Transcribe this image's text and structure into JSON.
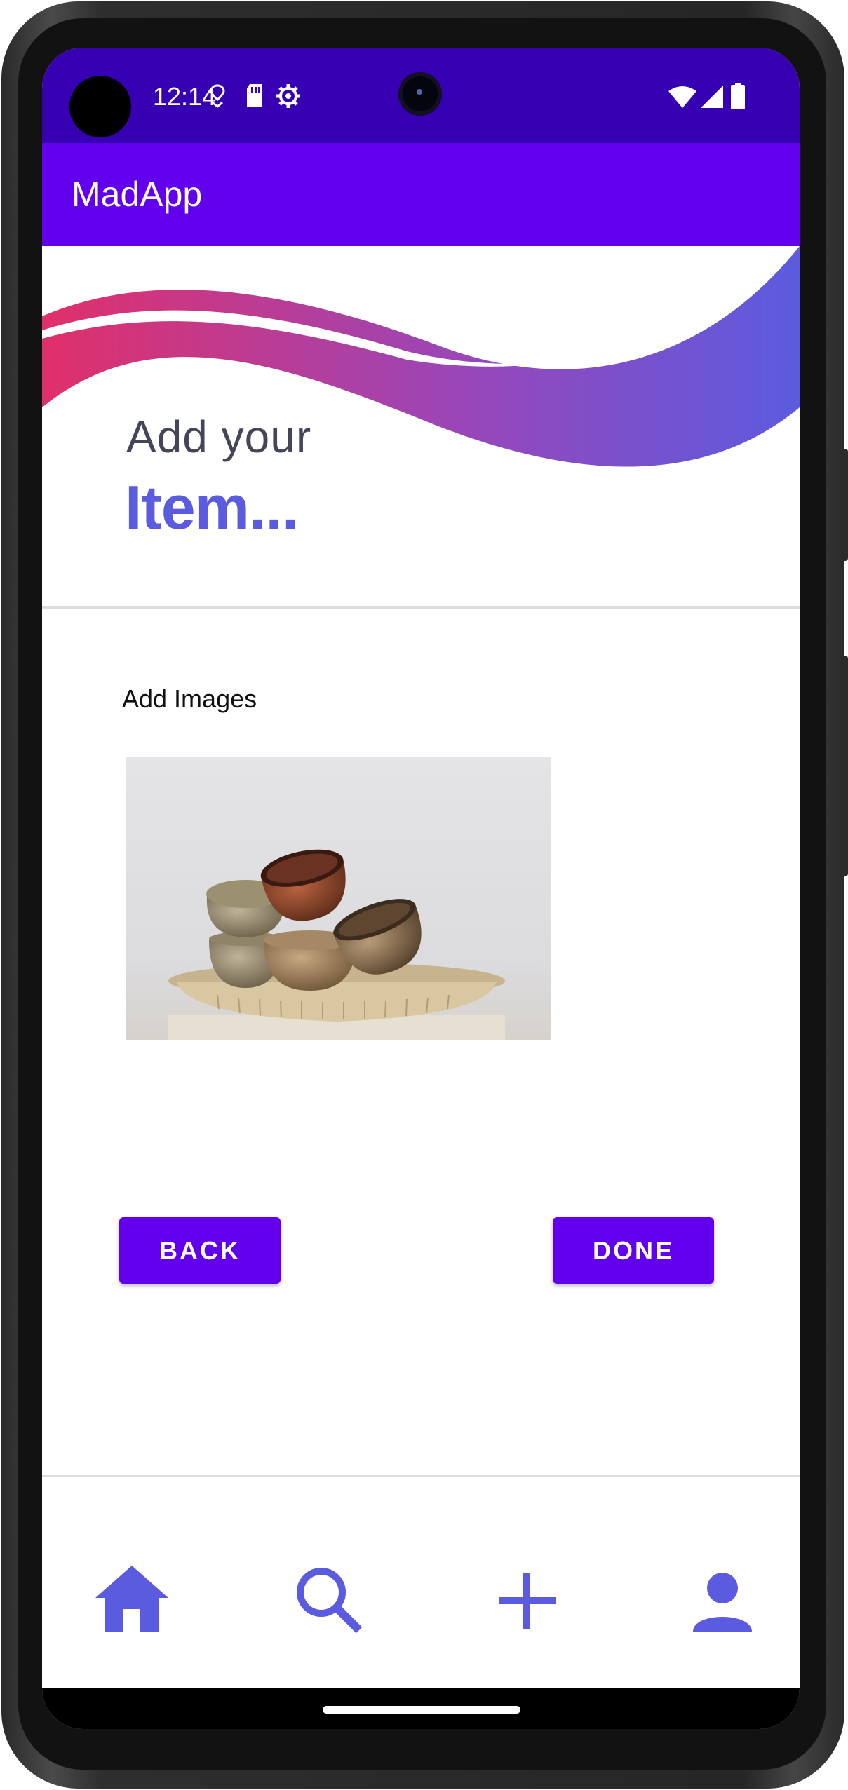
{
  "status_bar": {
    "time": "12:14",
    "icons": [
      "location-pin-icon",
      "sd-card-icon",
      "settings-gear-icon",
      "wifi-icon",
      "cell-signal-icon",
      "battery-icon"
    ]
  },
  "app_bar": {
    "title": "MadApp"
  },
  "header": {
    "line1": "Add your",
    "line2": "Item..."
  },
  "images_section": {
    "label": "Add Images",
    "image_alt": "Stacked clay pottery bowls on a round tray"
  },
  "actions": {
    "back_label": "BACK",
    "done_label": "DONE"
  },
  "bottom_nav": {
    "items": [
      "home-icon",
      "search-icon",
      "add-icon",
      "profile-icon"
    ]
  },
  "colors": {
    "status_bar": "#3700b3",
    "app_bar": "#6200ee",
    "accent": "#5b5bdf",
    "button": "#6200ee",
    "wave_start": "#e0306a",
    "wave_end": "#5b5bdf"
  }
}
